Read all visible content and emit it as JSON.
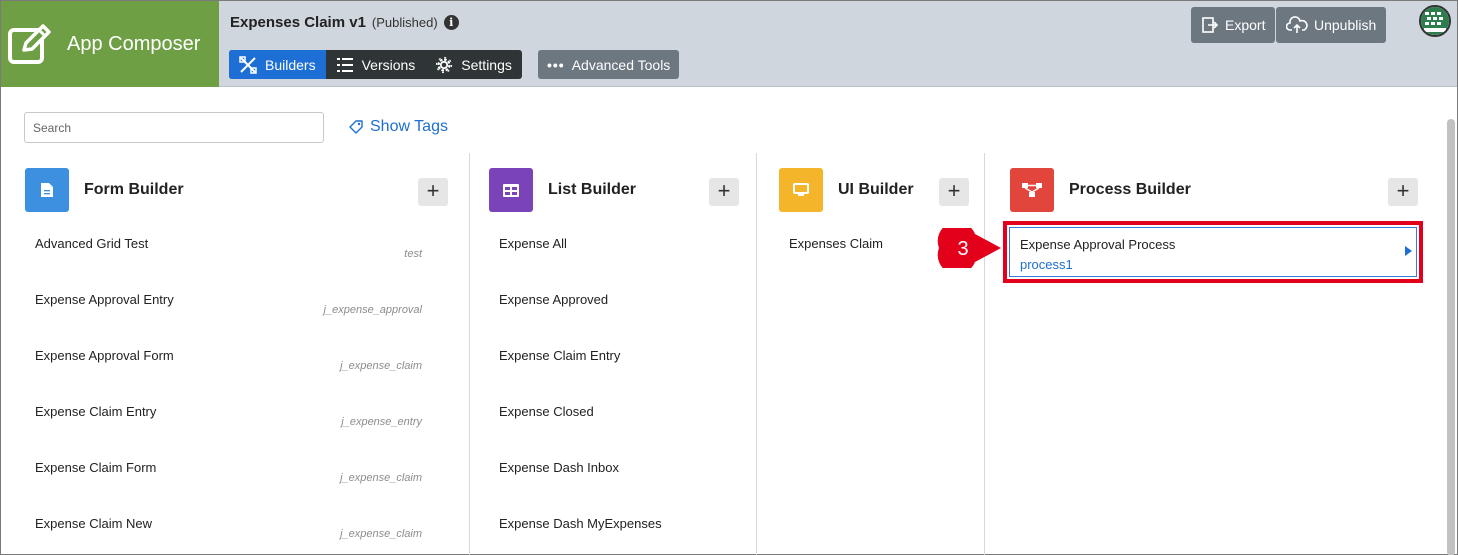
{
  "brand": {
    "name": "App Composer"
  },
  "app": {
    "title": "Expenses Claim v1",
    "status": "(Published)"
  },
  "tabs": [
    {
      "label": "Builders",
      "active": true
    },
    {
      "label": "Versions",
      "active": false
    },
    {
      "label": "Settings",
      "active": false
    }
  ],
  "advanced_tools": "Advanced Tools",
  "actions": {
    "export": "Export",
    "unpublish": "Unpublish"
  },
  "search": {
    "placeholder": "Search"
  },
  "show_tags": "Show Tags",
  "columns": {
    "form": {
      "title": "Form Builder",
      "color": "#3d8fe0",
      "items": [
        {
          "name": "Advanced Grid Test",
          "tag": "test"
        },
        {
          "name": "Expense Approval Entry",
          "tag": "j_expense_approval"
        },
        {
          "name": "Expense Approval Form",
          "tag": "j_expense_claim"
        },
        {
          "name": "Expense Claim Entry",
          "tag": "j_expense_entry"
        },
        {
          "name": "Expense Claim Form",
          "tag": "j_expense_claim"
        },
        {
          "name": "Expense Claim New",
          "tag": "j_expense_claim"
        }
      ]
    },
    "list": {
      "title": "List Builder",
      "color": "#7b43b8",
      "items": [
        {
          "name": "Expense All"
        },
        {
          "name": "Expense Approved"
        },
        {
          "name": "Expense Claim Entry"
        },
        {
          "name": "Expense Closed"
        },
        {
          "name": "Expense Dash Inbox"
        },
        {
          "name": "Expense Dash MyExpenses"
        }
      ]
    },
    "ui": {
      "title": "UI Builder",
      "color": "#f4b52a",
      "items": [
        {
          "name": "Expenses Claim"
        }
      ]
    },
    "process": {
      "title": "Process Builder",
      "color": "#e2453c",
      "items": [
        {
          "name": "Expense Approval Process",
          "id": "process1"
        }
      ]
    }
  },
  "callout": {
    "number": "3",
    "color": "#e3001b"
  }
}
